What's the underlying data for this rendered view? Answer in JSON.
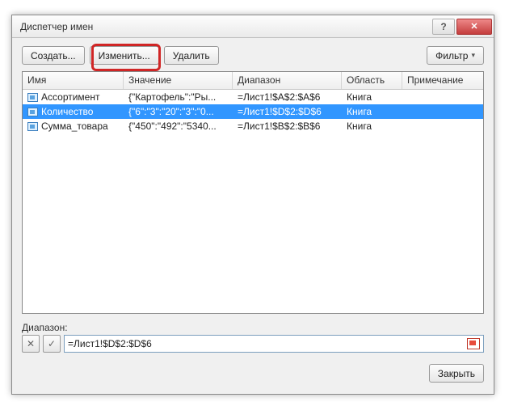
{
  "title": "Диспетчер имен",
  "toolbar": {
    "create": "Создать...",
    "edit": "Изменить...",
    "delete": "Удалить",
    "filter": "Фильтр"
  },
  "columns": {
    "name": "Имя",
    "value": "Значение",
    "range": "Диапазон",
    "scope": "Область",
    "comment": "Примечание"
  },
  "rows": [
    {
      "name": "Ассортимент",
      "value": "{\"Картофель\":\"Ры...",
      "range": "=Лист1!$A$2:$A$6",
      "scope": "Книга",
      "selected": false
    },
    {
      "name": "Количество",
      "value": "{\"6\":\"3\":\"20\":\"3\":\"0...",
      "range": "=Лист1!$D$2:$D$6",
      "scope": "Книга",
      "selected": true
    },
    {
      "name": "Сумма_товара",
      "value": "{\"450\":\"492\":\"5340...",
      "range": "=Лист1!$B$2:$B$6",
      "scope": "Книга",
      "selected": false
    }
  ],
  "range": {
    "label": "Диапазон:",
    "value": "=Лист1!$D$2:$D$6"
  },
  "close": "Закрыть"
}
